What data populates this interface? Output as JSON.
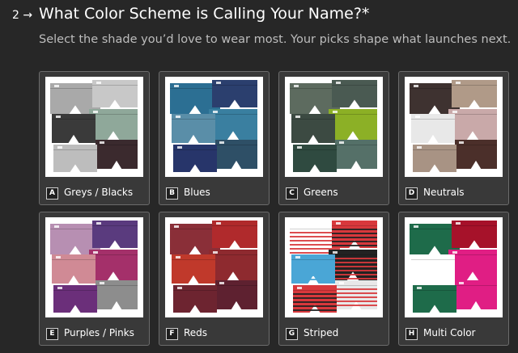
{
  "question": {
    "number": "2 →",
    "title": "What Color Scheme is Calling Your Name?*",
    "subtitle": "Select the shade you’d love to wear most. Your picks shape what launches next."
  },
  "options": [
    {
      "key": "A",
      "label": "Greys / Blacks",
      "image_icon": "greys-blacks-underwear-image",
      "colors": [
        "#a9a9a9",
        "#c8c8c8",
        "#8fa89a",
        "#3a3a3a",
        "#3b2a2e",
        "#bdbdbd"
      ]
    },
    {
      "key": "B",
      "label": "Blues",
      "image_icon": "blues-underwear-image",
      "colors": [
        "#2c6f93",
        "#2b3f6e",
        "#3a7fa0",
        "#5a8ea8",
        "#2e4f66",
        "#27356a"
      ]
    },
    {
      "key": "C",
      "label": "Greens",
      "image_icon": "greens-underwear-image",
      "colors": [
        "#5d6b5f",
        "#4a5a52",
        "#8cb026",
        "#3c4a42",
        "#557068",
        "#2f4a40"
      ]
    },
    {
      "key": "D",
      "label": "Neutrals",
      "image_icon": "neutrals-underwear-image",
      "colors": [
        "#3e3230",
        "#b09a88",
        "#c9a9a9",
        "#e8e8e8",
        "#4b2f2a",
        "#a89384"
      ]
    },
    {
      "key": "E",
      "label": "Purples / Pinks",
      "image_icon": "purples-pinks-underwear-image",
      "colors": [
        "#b78fb2",
        "#5a3b7e",
        "#a4306a",
        "#d08a95",
        "#8d8d8d",
        "#6b2f7a"
      ]
    },
    {
      "key": "F",
      "label": "Reds",
      "image_icon": "reds-underwear-image",
      "colors": [
        "#8a2f38",
        "#b02a2c",
        "#8e2a2f",
        "#c0392b",
        "#5e2130",
        "#6d2430"
      ]
    },
    {
      "key": "G",
      "label": "Striped",
      "image_icon": "striped-underwear-image",
      "colors": [
        "#ffffff",
        "#d8383c",
        "#222222",
        "#4aa6d6",
        "#e8e8e8",
        "#d8383c"
      ]
    },
    {
      "key": "H",
      "label": "Multi Color",
      "image_icon": "multi-color-underwear-image",
      "colors": [
        "#1e6b4a",
        "#a6122a",
        "#e01e84",
        "#ffffff",
        "#e01e84",
        "#1e6b4a"
      ]
    }
  ]
}
